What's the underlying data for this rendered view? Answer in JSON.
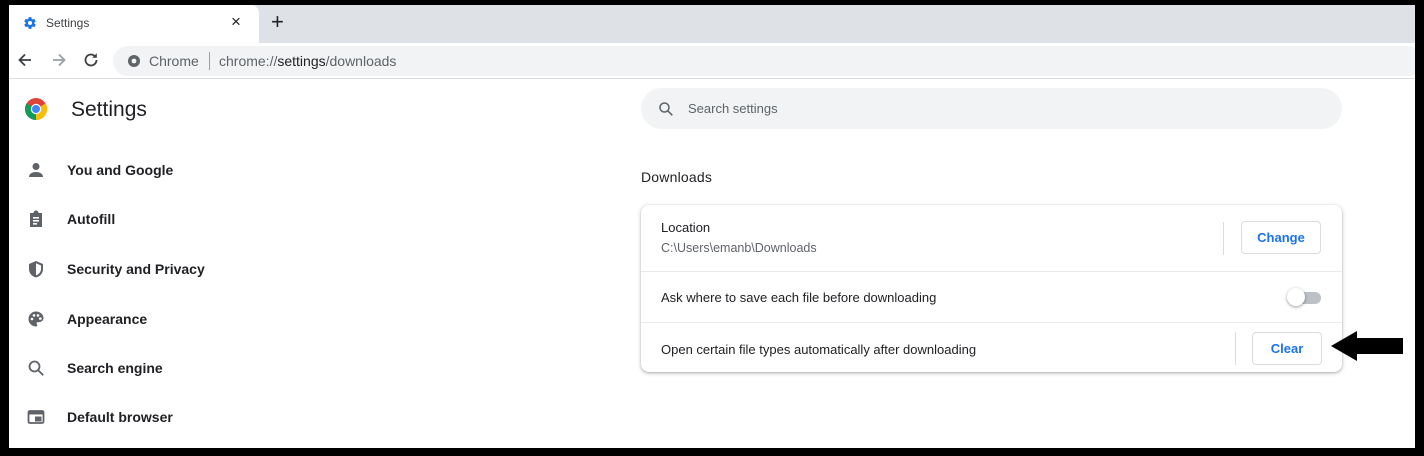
{
  "browser": {
    "tab_title": "Settings",
    "close_glyph": "×",
    "new_tab_glyph": "+",
    "omnibox_site": "Chrome",
    "omnibox_url_prefix": "chrome://",
    "omnibox_url_bold": "settings",
    "omnibox_url_suffix": "/downloads"
  },
  "sidebar": {
    "title": "Settings",
    "items": [
      {
        "label": "You and Google",
        "icon": "person-icon"
      },
      {
        "label": "Autofill",
        "icon": "clipboard-icon"
      },
      {
        "label": "Security and Privacy",
        "icon": "shield-icon"
      },
      {
        "label": "Appearance",
        "icon": "palette-icon"
      },
      {
        "label": "Search engine",
        "icon": "search-icon"
      },
      {
        "label": "Default browser",
        "icon": "browser-window-icon"
      }
    ]
  },
  "search": {
    "placeholder": "Search settings"
  },
  "downloads": {
    "section_title": "Downloads",
    "location_label": "Location",
    "location_path": "C:\\Users\\emanb\\Downloads",
    "change_button": "Change",
    "ask_label": "Ask where to save each file before downloading",
    "ask_enabled": false,
    "open_types_label": "Open certain file types automatically after downloading",
    "clear_button": "Clear"
  },
  "colors": {
    "accent": "#1a73e8",
    "toggle_off": "#bdc1c6",
    "tabstrip": "#dee1e6",
    "omnibox": "#f1f3f4"
  }
}
